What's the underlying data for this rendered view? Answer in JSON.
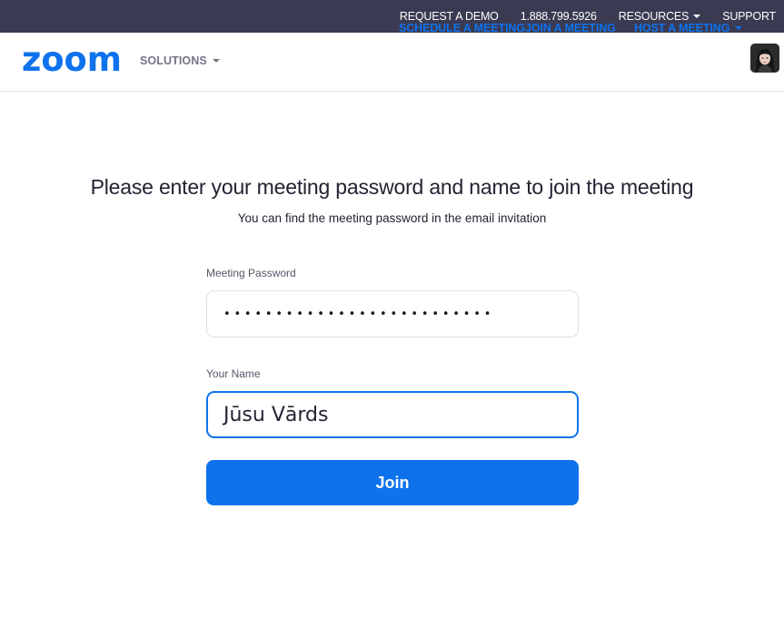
{
  "topbar": {
    "request_demo": "REQUEST A DEMO",
    "phone": "1.888.799.5926",
    "resources": "RESOURCES",
    "support": "SUPPORT"
  },
  "navbar": {
    "logo_text": "zoom",
    "solutions": "SOLUTIONS",
    "schedule": "SCHEDULE A MEETING",
    "join": "JOIN A MEETING",
    "host": "HOST A MEETING"
  },
  "form": {
    "heading": "Please enter your meeting password and name to join the meeting",
    "subheading": "You can find the meeting password in the email invitation",
    "password_label": "Meeting Password",
    "password_value": "••••••••••••••••••••••••••",
    "name_label": "Your Name",
    "name_value": "Jūsu Vārds",
    "join_label": "Join"
  },
  "colors": {
    "topbar_bg": "#3a3a52",
    "brand_blue": "#0e72ed",
    "text_dark": "#232333",
    "text_gray": "#747487"
  },
  "icons": {
    "resources_caret": "caret-down-icon",
    "solutions_caret": "caret-down-icon",
    "host_caret": "caret-down-icon"
  }
}
